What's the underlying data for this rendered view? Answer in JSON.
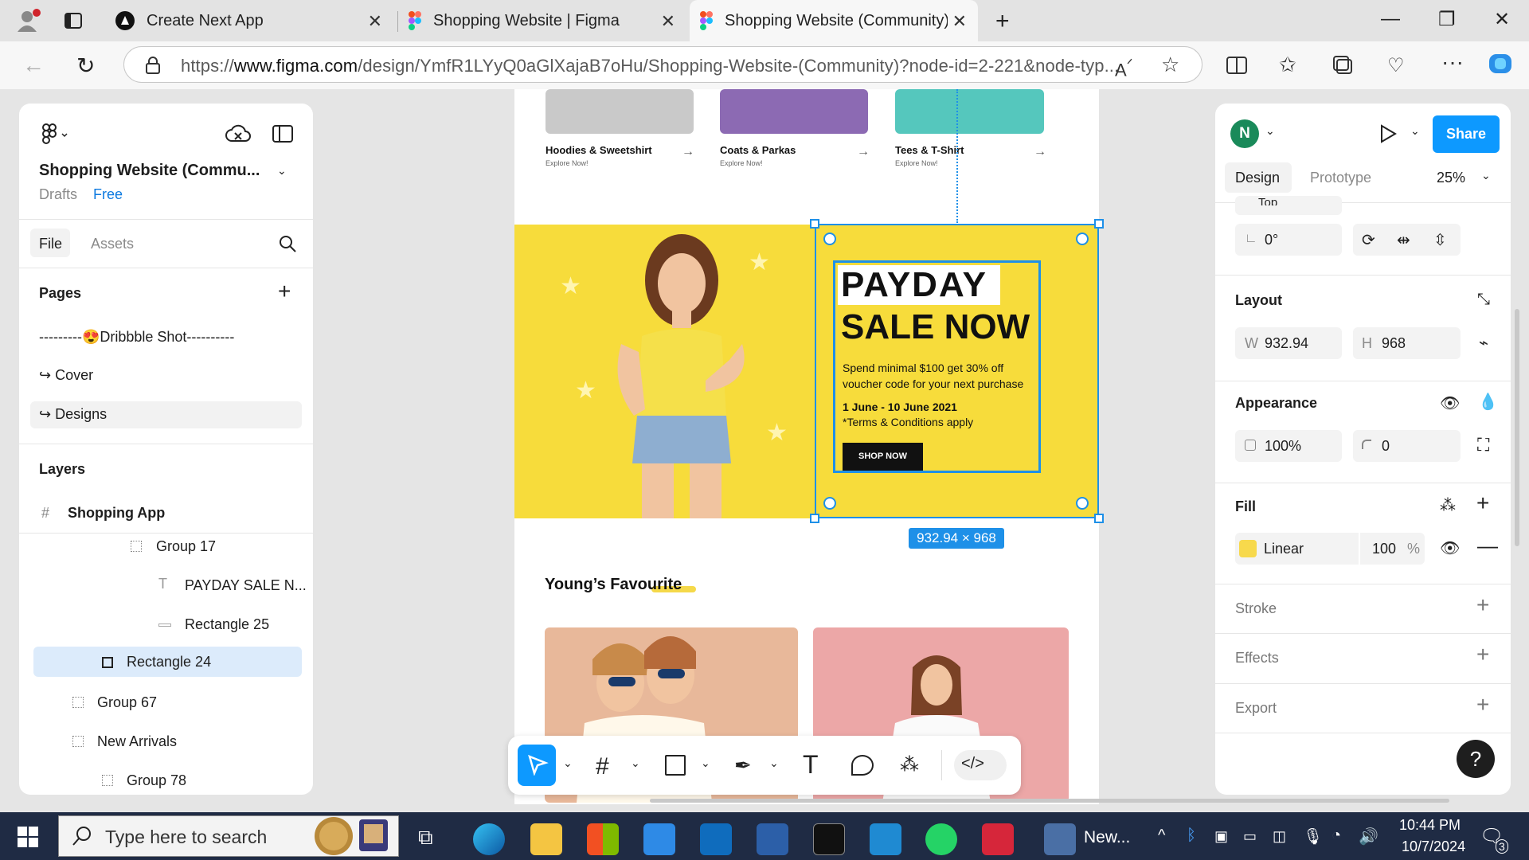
{
  "browser": {
    "tabs": [
      {
        "title": "Create Next App",
        "active": false
      },
      {
        "title": "Shopping Website | Figma",
        "active": false
      },
      {
        "title": "Shopping Website (Community) –",
        "active": true
      }
    ],
    "url_prefix": "https://",
    "url_domain": "www.figma.com",
    "url_path": "/design/YmfR1LYyQ0aGlXajaB7oHu/Shopping-Website-(Community)?node-id=2-221&node-typ..."
  },
  "figma": {
    "file_title": "Shopping Website (Commu...",
    "location": "Drafts",
    "plan": "Free",
    "tabs": {
      "file": "File",
      "assets": "Assets"
    },
    "pages_heading": "Pages",
    "pages": [
      {
        "label": "---------😍Dribbble Shot----------",
        "selected": false
      },
      {
        "label": "↪ Cover",
        "selected": false
      },
      {
        "label": "↪ Designs",
        "selected": true
      }
    ],
    "layers_heading": "Layers",
    "frame_name": "Shopping App",
    "layers": [
      {
        "label": "Group 17",
        "icon": "group-icon",
        "selected": false
      },
      {
        "label": "PAYDAY SALE N...",
        "icon": "text-icon",
        "selected": false
      },
      {
        "label": "Rectangle 25",
        "icon": "line-icon",
        "selected": false
      },
      {
        "label": "Rectangle 24",
        "icon": "rectangle-icon",
        "selected": true
      },
      {
        "label": "Group 67",
        "icon": "group-icon",
        "selected": false
      },
      {
        "label": "New Arrivals",
        "icon": "group-icon",
        "selected": false
      },
      {
        "label": "Group 78",
        "icon": "group-icon",
        "selected": false
      }
    ],
    "right": {
      "avatar": "N",
      "share": "Share",
      "tab_design": "Design",
      "tab_prototype": "Prototype",
      "zoom": "25%",
      "constraint": "Top",
      "rotation": "0°",
      "layout_heading": "Layout",
      "width_label": "W",
      "width": "932.94",
      "height_label": "H",
      "height": "968",
      "appearance_heading": "Appearance",
      "opacity": "100%",
      "radius": "0",
      "fill_heading": "Fill",
      "fill_type": "Linear",
      "fill_opacity": "100",
      "fill_unit": "%",
      "fill_color": "#f7d94c",
      "stroke_heading": "Stroke",
      "effects_heading": "Effects",
      "export_heading": "Export",
      "help": "?"
    }
  },
  "canvas": {
    "products": [
      {
        "title": "Hoodies & Sweetshirt",
        "sub": "Explore Now!",
        "color": "#c9c9c9"
      },
      {
        "title": "Coats & Parkas",
        "sub": "Explore Now!",
        "color": "#8c6ab3"
      },
      {
        "title": "Tees & T-Shirt",
        "sub": "Explore Now!",
        "color": "#55c7bd"
      }
    ],
    "banner": {
      "headline_1": "PAYDAY",
      "headline_2": "SALE NOW",
      "body": "Spend minimal $100 get 30% off voucher code for your next purchase",
      "dates": "1 June - 10 June 2021",
      "terms": "*Terms & Conditions apply",
      "cta": "SHOP NOW",
      "bg_color": "#f7dc3b"
    },
    "selection_label": "932.94 × 968",
    "section_title": "Young’s Favourite"
  },
  "taskbar": {
    "search_placeholder": "Type here to search",
    "news_label": "New...",
    "time": "10:44 PM",
    "date": "10/7/2024",
    "notifications": "3"
  },
  "colors": {
    "accent": "#1e90e8",
    "share": "#0d99ff"
  }
}
